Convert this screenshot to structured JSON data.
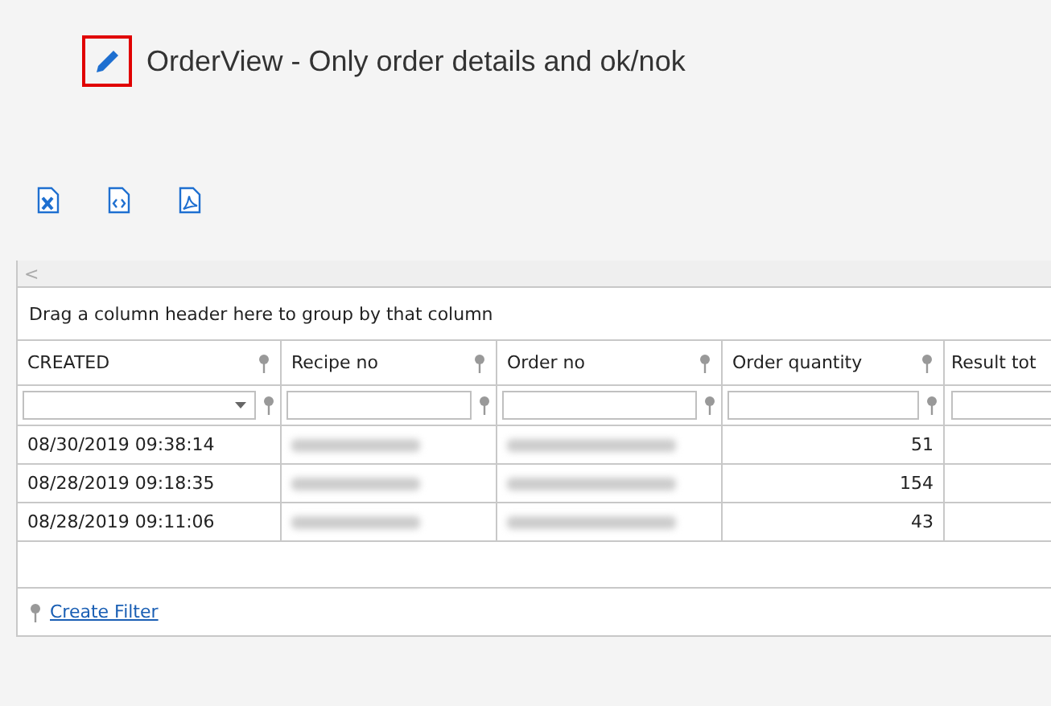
{
  "title": "OrderView - Only order details and ok/nok",
  "export_buttons": [
    {
      "kind": "excel"
    },
    {
      "kind": "xml"
    },
    {
      "kind": "pdf"
    }
  ],
  "scroll_left": "<",
  "group_panel": "Drag a column header here to group by that column",
  "columns": [
    {
      "label": "CREATED",
      "kind": "dropdown"
    },
    {
      "label": "Recipe no",
      "kind": "text"
    },
    {
      "label": "Order no",
      "kind": "text"
    },
    {
      "label": "Order quantity",
      "kind": "text"
    },
    {
      "label": "Result tot",
      "kind": "text"
    }
  ],
  "rows": [
    {
      "created": "08/30/2019 09:38:14",
      "recipe_redacted": true,
      "order_redacted": true,
      "quantity": "51"
    },
    {
      "created": "08/28/2019 09:18:35",
      "recipe_redacted": true,
      "order_redacted": true,
      "quantity": "154"
    },
    {
      "created": "08/28/2019 09:11:06",
      "recipe_redacted": true,
      "order_redacted": true,
      "quantity": "43"
    }
  ],
  "create_filter": "Create Filter"
}
